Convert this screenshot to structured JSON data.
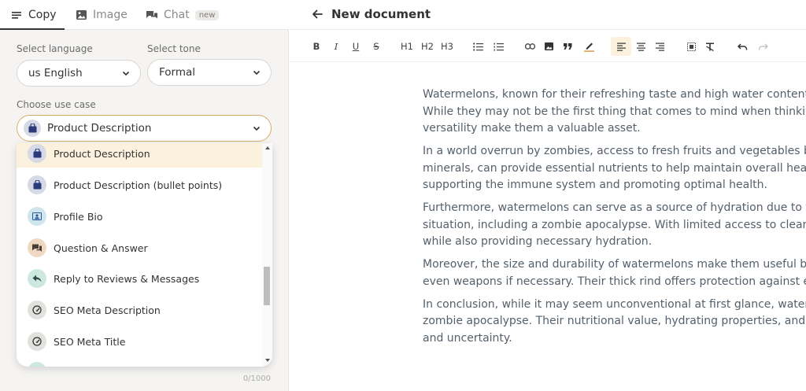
{
  "tabs": [
    {
      "label": "Copy",
      "icon": "lines-icon"
    },
    {
      "label": "Image",
      "icon": "image-icon"
    },
    {
      "label": "Chat",
      "icon": "chat-icon",
      "badge": "new"
    }
  ],
  "form": {
    "language_label": "Select language",
    "language_value": "us English",
    "tone_label": "Select tone",
    "tone_value": "Formal",
    "usecase_label": "Choose use case",
    "usecase_value": "Product Description"
  },
  "dropdown": {
    "items": [
      {
        "label": "Product Description",
        "icon": "bag-icon",
        "color": "#d6d9e6"
      },
      {
        "label": "Product Description (bullet points)",
        "icon": "bag-icon",
        "color": "#d6d9e6"
      },
      {
        "label": "Profile Bio",
        "icon": "profile-icon",
        "color": "#cfe6ee"
      },
      {
        "label": "Question & Answer",
        "icon": "question-icon",
        "color": "#f0d9c3"
      },
      {
        "label": "Reply to Reviews & Messages",
        "icon": "reply-icon",
        "color": "#cde8e0"
      },
      {
        "label": "SEO Meta Description",
        "icon": "gauge-icon",
        "color": "#e2e1de"
      },
      {
        "label": "SEO Meta Title",
        "icon": "gauge-icon",
        "color": "#e2e1de"
      }
    ]
  },
  "counter": "0/1000",
  "document": {
    "title": "New document",
    "toolbar": [
      "B",
      "I",
      "U",
      "S",
      "H1",
      "H2",
      "H3"
    ],
    "paragraphs": [
      [
        "Watermelons, known for their refreshing taste and high water content",
        "While they may not be the first thing that comes to mind when thinkin",
        "versatility make them a valuable asset."
      ],
      [
        "In a world overrun by zombies, access to fresh fruits and vegetables be",
        "minerals, can provide essential nutrients to help maintain overall healt",
        "supporting the immune system and promoting optimal health."
      ],
      [
        "Furthermore, watermelons can serve as a source of hydration due to th",
        "situation, including a zombie apocalypse. With limited access to clean",
        "while also providing necessary hydration."
      ],
      [
        "Moreover, the size and durability of watermelons make them useful be",
        "even weapons if necessary. Their thick rind offers protection against ex"
      ],
      [
        "In conclusion, while it may seem unconventional at first glance, waterr",
        "zombie apocalypse. Their nutritional value, hydrating properties, and v",
        "and uncertainty."
      ]
    ]
  },
  "colors": {
    "accent": "#d9ac68",
    "selected_bg": "#fbf1dc"
  }
}
